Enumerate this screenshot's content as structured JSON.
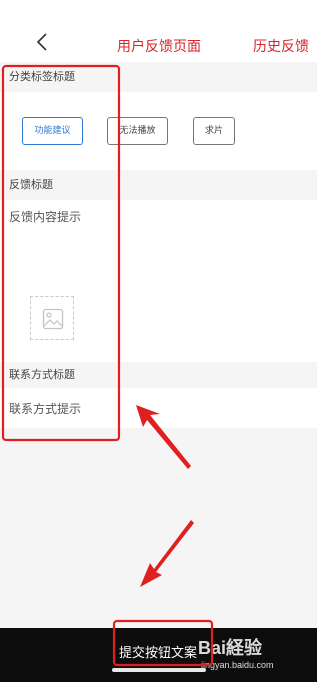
{
  "header": {
    "title": "用户反馈页面",
    "history_link": "历史反馈",
    "back_icon": "chevron-left-icon"
  },
  "category": {
    "title": "分类标签标题",
    "tags": [
      {
        "label": "功能建议",
        "selected": true
      },
      {
        "label": "无法播放",
        "selected": false
      },
      {
        "label": "求片",
        "selected": false
      }
    ]
  },
  "feedback": {
    "title": "反馈标题",
    "placeholder": "反馈内容提示",
    "image_icon": "image-upload-icon"
  },
  "contact": {
    "title": "联系方式标题",
    "placeholder": "联系方式提示"
  },
  "submit": {
    "label": "提交按钮文案"
  },
  "watermark": {
    "logo": "Bai経验",
    "url": "jingyan.baidu.com"
  },
  "colors": {
    "accent_red": "#d6262b",
    "selected_blue": "#2b7bd4",
    "annotation_red": "#e02020",
    "submit_bg": "#0d0d0d"
  }
}
